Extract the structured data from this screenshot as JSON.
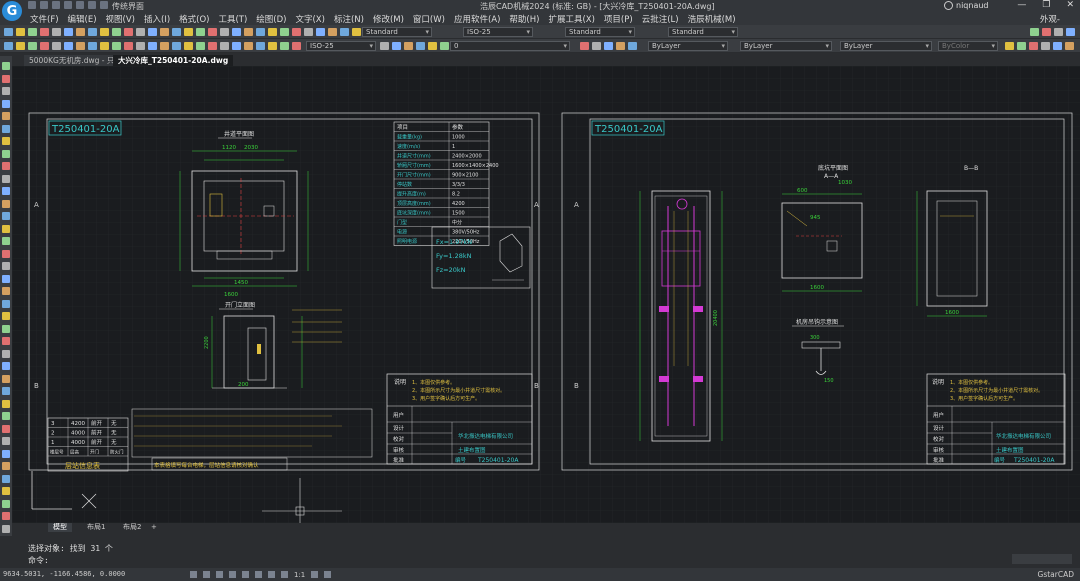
{
  "app": {
    "title": "浩辰CAD机械2024 (标准: GB) - [大兴冷库_T250401-20A.dwg]",
    "workspace": "传统界面",
    "user": "niqnaud",
    "window_controls": [
      "—",
      "❐",
      "✕"
    ]
  },
  "menu": {
    "items": [
      "文件(F)",
      "编辑(E)",
      "视图(V)",
      "插入(I)",
      "格式(O)",
      "工具(T)",
      "绘图(D)",
      "文字(X)",
      "标注(N)",
      "修改(M)",
      "窗口(W)",
      "应用软件(A)",
      "帮助(H)",
      "扩展工具(X)",
      "项目(P)",
      "云批注(L)",
      "浩辰机械(M)"
    ],
    "right": "外观-"
  },
  "toolbar": {
    "textstyle": "Standard",
    "dimstyle": "ISO-25",
    "tablestyle": "Standard",
    "mleaderstyle": "Standard",
    "layer": "0",
    "color": "ByLayer",
    "linetype": "ByLayer",
    "lineweight": "ByLayer",
    "plotstyle": "ByColor"
  },
  "tabs": {
    "file1": "5000KG无机房.dwg - 只读",
    "file2": "大兴冷库_T250401-20A.dwg"
  },
  "drawing": {
    "left_sheet_id": "T250401-20A",
    "right_sheet_id": "T250401-20A",
    "zone_a": "A",
    "zone_b": "B",
    "label_top_view": "井道平面图",
    "label_door_elev": "开门立面图",
    "label_section_aa": "A—A",
    "label_section_bb": "B—B",
    "label_pit_view": "底坑平面图",
    "label_machine_detail": "机房吊钩示意图",
    "force_fx": "Fx=1.97kN",
    "force_fy": "Fy=1.28kN",
    "force_fz": "Fz=20kN",
    "fl_rows": [
      [
        "3",
        "4200",
        "前开",
        "无"
      ],
      [
        "2",
        "4000",
        "前开",
        "无"
      ],
      [
        "1",
        "4000",
        "前开",
        "无"
      ]
    ],
    "fl_header": [
      "楼层号",
      "层高",
      "开门",
      "防火门"
    ],
    "fl_title": "层站信息表",
    "note_bottom": "本表格填写每台电梯，层站信息请核对确认",
    "notes_title": "说明",
    "notes": [
      "1、本图仅供参考。",
      "2、本图所示尺寸为最小井道尺寸需核对。",
      "3、用户签字确认后方可生产。"
    ],
    "company": "华北振达电梯有限公司",
    "block_rows": [
      "用户",
      "设计",
      "校对",
      "审核",
      "批准"
    ],
    "drawing_no_label": "编号",
    "drawing_name": "土建布置图",
    "dim_1120": "1120",
    "dim_2030": "2030",
    "dim_1600": "1600",
    "dim_600": "600",
    "dim_945": "945",
    "dim_1030": "1030",
    "dim_1450": "1450",
    "dim_2200": "2200",
    "dim_200": "200",
    "dim_300": "300",
    "dim_150": "150",
    "dim_20400": "20400"
  },
  "spec_table": {
    "header": [
      "项目",
      "参数"
    ],
    "rows": [
      [
        "载重量(kg)",
        "1000"
      ],
      [
        "速度(m/s)",
        "1"
      ],
      [
        "井道尺寸(mm)",
        "2400×2000"
      ],
      [
        "轿厢尺寸(mm)",
        "1600×1400×2400"
      ],
      [
        "开门尺寸(mm)",
        "900×2100"
      ],
      [
        "停站数",
        "3/3/3"
      ],
      [
        "提升高度(m)",
        "8.2"
      ],
      [
        "顶层高度(mm)",
        "4200"
      ],
      [
        "底坑深度(mm)",
        "1500"
      ],
      [
        "门型",
        "中分"
      ],
      [
        "电源",
        "380V/50Hz"
      ],
      [
        "照明电源",
        "220V/50Hz"
      ]
    ]
  },
  "layout_tabs": [
    "模型",
    "布局1",
    "布局2",
    "+"
  ],
  "command": {
    "line1": "选择对象: 找到 31 个",
    "line2": "命令:"
  },
  "status": {
    "coords": "9634.5031, -1166.4586, 0.0000",
    "scale": "1:1",
    "brand": "GstarCAD"
  }
}
